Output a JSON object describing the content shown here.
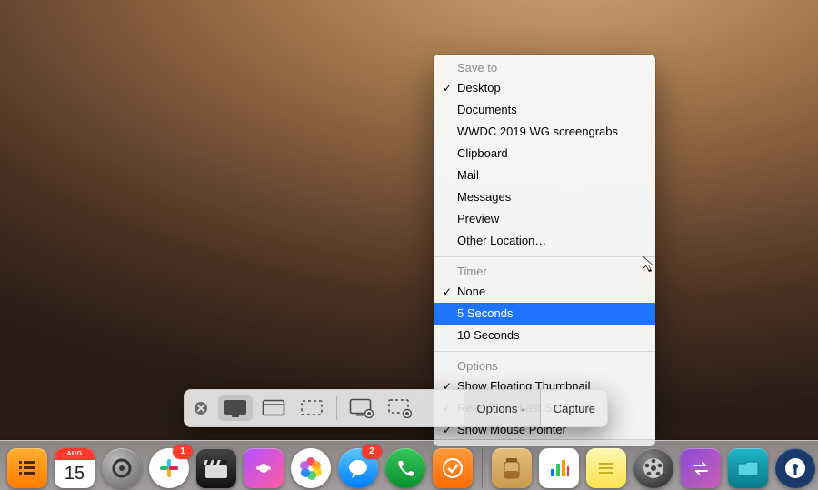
{
  "toolbar": {
    "options_label": "Options",
    "capture_label": "Capture",
    "tools": [
      {
        "name": "capture-entire-screen",
        "selected": true
      },
      {
        "name": "capture-window",
        "selected": false
      },
      {
        "name": "capture-selection",
        "selected": false
      },
      {
        "name": "record-entire-screen",
        "selected": false
      },
      {
        "name": "record-selection",
        "selected": false
      }
    ]
  },
  "menu": {
    "sections": [
      {
        "title": "Save to",
        "items": [
          {
            "label": "Desktop",
            "checked": true
          },
          {
            "label": "Documents",
            "checked": false
          },
          {
            "label": "WWDC 2019 WG screengrabs",
            "checked": false
          },
          {
            "label": "Clipboard",
            "checked": false
          },
          {
            "label": "Mail",
            "checked": false
          },
          {
            "label": "Messages",
            "checked": false
          },
          {
            "label": "Preview",
            "checked": false
          },
          {
            "label": "Other Location…",
            "checked": false
          }
        ]
      },
      {
        "title": "Timer",
        "items": [
          {
            "label": "None",
            "checked": true
          },
          {
            "label": "5 Seconds",
            "checked": false,
            "highlighted": true
          },
          {
            "label": "10 Seconds",
            "checked": false
          }
        ]
      },
      {
        "title": "Options",
        "items": [
          {
            "label": "Show Floating Thumbnail",
            "checked": true
          },
          {
            "label": "Remember Last Selection",
            "checked": true
          },
          {
            "label": "Show Mouse Pointer",
            "checked": true
          }
        ]
      }
    ]
  },
  "calendar": {
    "month": "AUG",
    "day": "15"
  },
  "dock_badges": {
    "slack": "1",
    "messages": "2"
  },
  "colors": {
    "highlight": "#1e74ff",
    "badge": "#ff3b30"
  }
}
